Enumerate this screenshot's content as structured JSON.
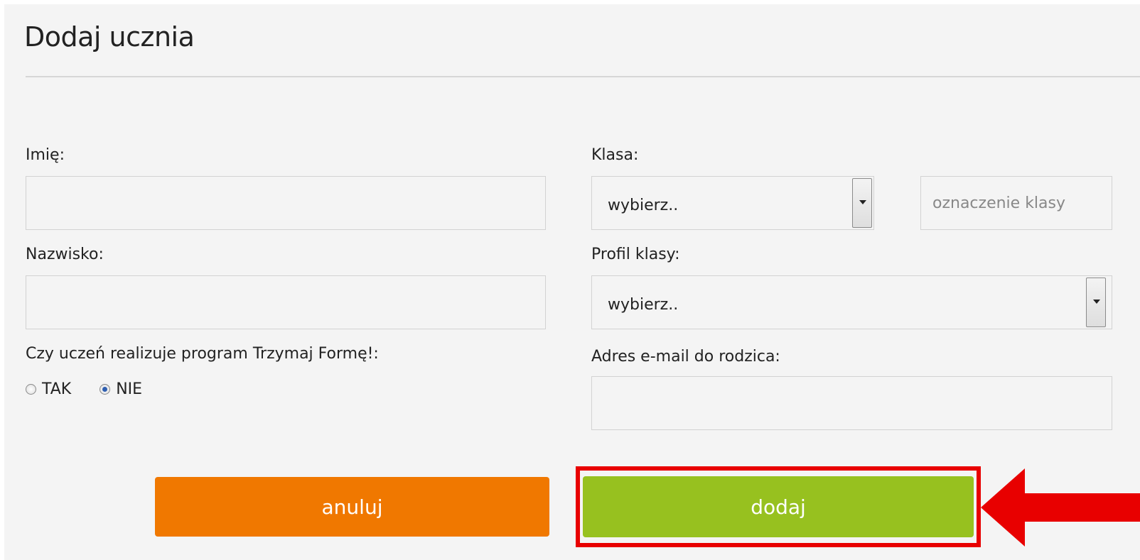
{
  "form": {
    "title": "Dodaj ucznia",
    "first_name": {
      "label": "Imię:",
      "value": ""
    },
    "last_name": {
      "label": "Nazwisko:",
      "value": ""
    },
    "program": {
      "label": "Czy uczeń realizuje program Trzymaj Formę!:",
      "options": [
        "TAK",
        "NIE"
      ],
      "selected": "NIE"
    },
    "class": {
      "label": "Klasa:",
      "select_value": "wybierz..",
      "designation_placeholder": "oznaczenie klasy",
      "designation_value": ""
    },
    "class_profile": {
      "label": "Profil klasy:",
      "select_value": "wybierz.."
    },
    "parent_email": {
      "label": "Adres e-mail do rodzica:",
      "value": ""
    },
    "buttons": {
      "cancel": "anuluj",
      "add": "dodaj"
    }
  },
  "colors": {
    "cancel_button": "#f07800",
    "add_button": "#97c11f",
    "annotation": "#e80000",
    "panel_background": "#f4f4f4"
  },
  "icons": {
    "select_arrow": "chevron-down-icon",
    "annotation_arrow": "arrow-left-icon"
  }
}
